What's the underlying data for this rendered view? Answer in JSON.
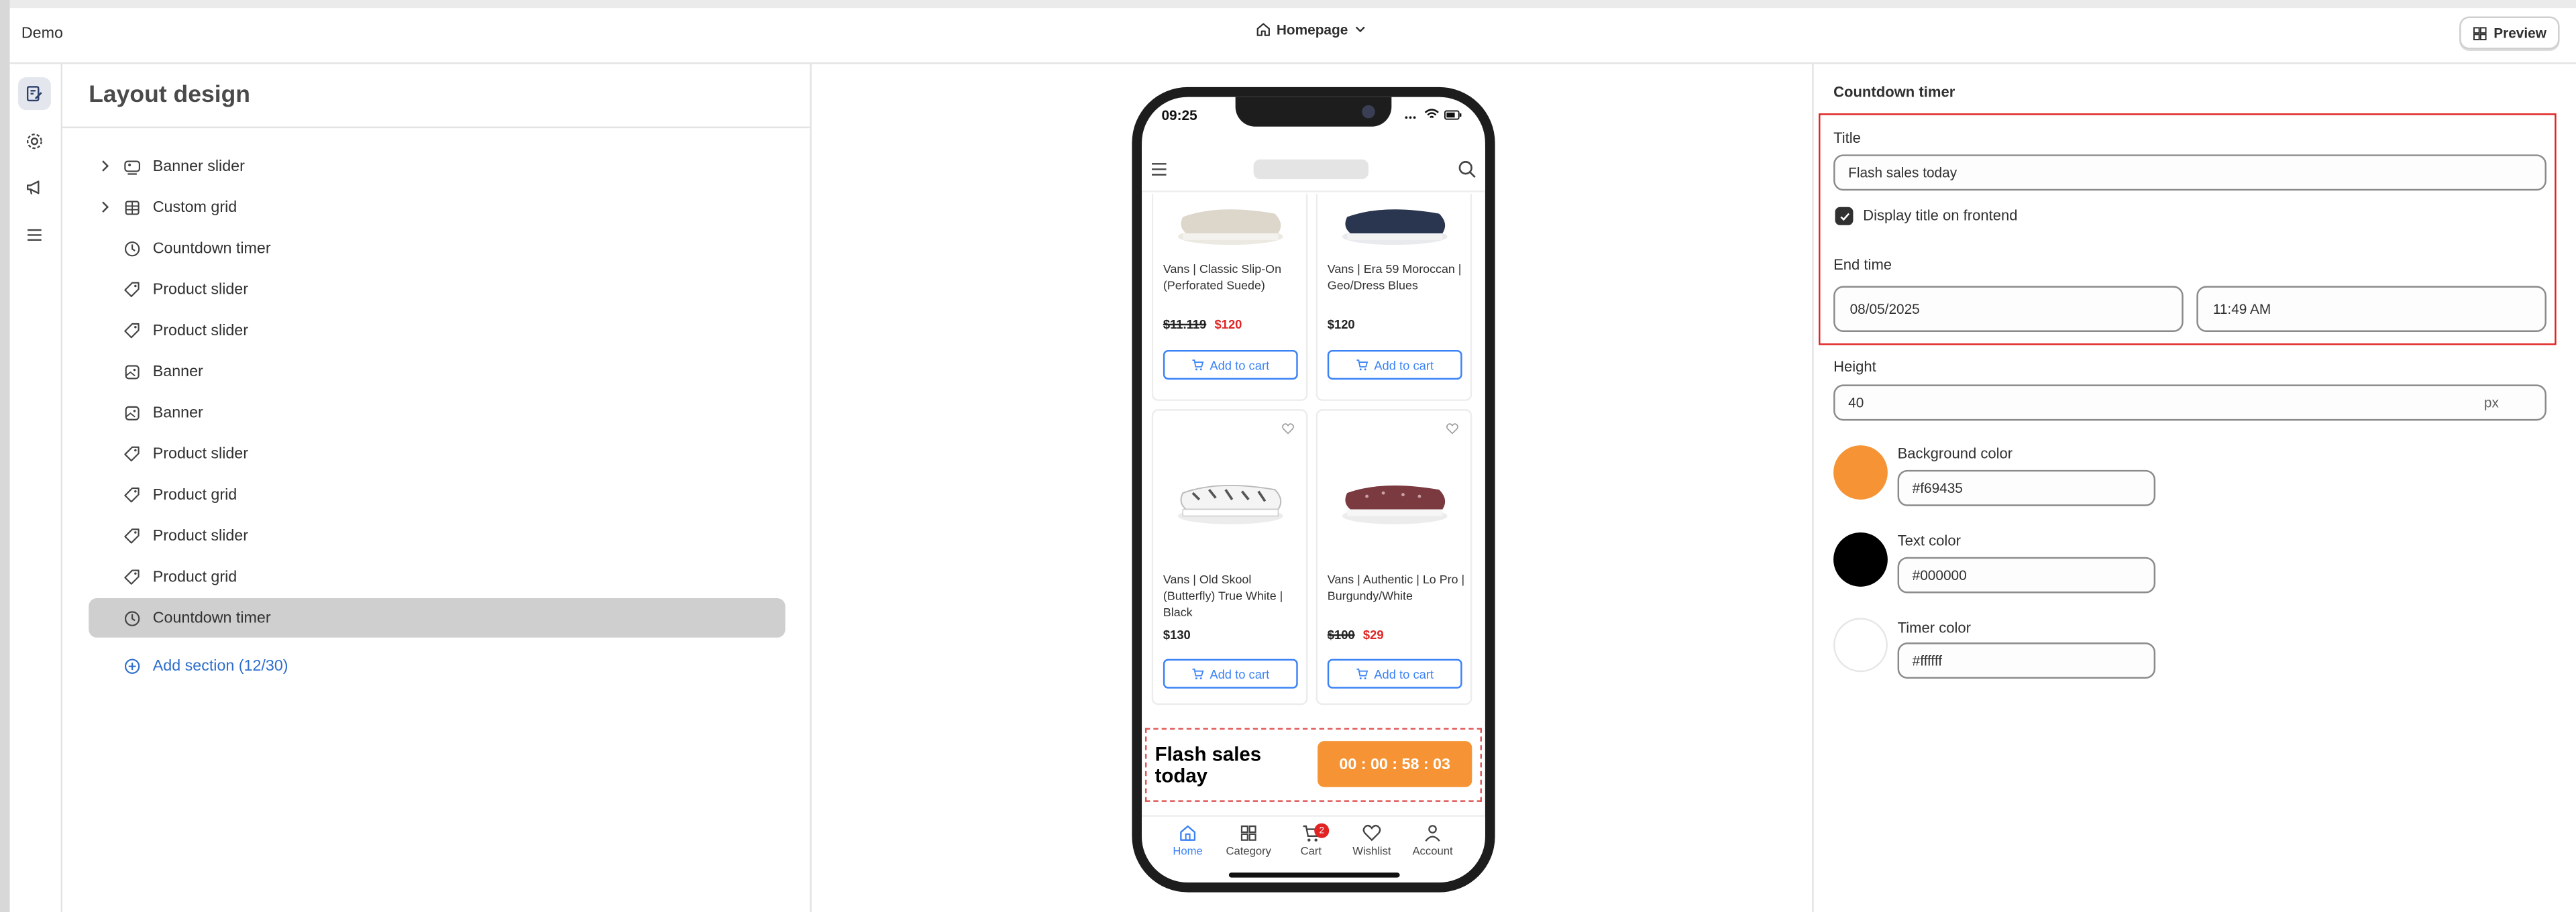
{
  "app": {
    "title": "Demo"
  },
  "topbar": {
    "page_select": "Homepage",
    "preview_label": "Preview"
  },
  "left_panel": {
    "title": "Layout design",
    "sections": [
      {
        "label": "Banner slider",
        "icon": "banner-slider-icon",
        "expandable": true
      },
      {
        "label": "Custom grid",
        "icon": "grid-icon",
        "expandable": true
      },
      {
        "label": "Countdown timer",
        "icon": "clock-icon",
        "expandable": false
      },
      {
        "label": "Product slider",
        "icon": "tag-icon",
        "expandable": false
      },
      {
        "label": "Product slider",
        "icon": "tag-icon",
        "expandable": false
      },
      {
        "label": "Banner",
        "icon": "image-icon",
        "expandable": false
      },
      {
        "label": "Banner",
        "icon": "image-icon",
        "expandable": false
      },
      {
        "label": "Product slider",
        "icon": "tag-icon",
        "expandable": false
      },
      {
        "label": "Product grid",
        "icon": "tag-icon",
        "expandable": false
      },
      {
        "label": "Product slider",
        "icon": "tag-icon",
        "expandable": false
      },
      {
        "label": "Product grid",
        "icon": "tag-icon",
        "expandable": false
      },
      {
        "label": "Countdown timer",
        "icon": "clock-icon",
        "expandable": false,
        "selected": true
      }
    ],
    "add_section_label": "Add section (12/30)"
  },
  "preview": {
    "status_time": "09:25",
    "products": [
      {
        "name": "Vans | Classic Slip-On (Perforated Suede)",
        "old_price": "$11.119",
        "price": "$120",
        "on_sale": true,
        "add_label": "Add to cart"
      },
      {
        "name": "Vans | Era 59 Moroccan | Geo/Dress Blues",
        "price": "$120",
        "on_sale": false,
        "add_label": "Add to cart"
      },
      {
        "name": "Vans | Old Skool (Butterfly) True White | Black",
        "price": "$130",
        "on_sale": false,
        "add_label": "Add to cart"
      },
      {
        "name": "Vans | Authentic | Lo Pro | Burgundy/White",
        "old_price": "$100",
        "price": "$29",
        "on_sale": true,
        "add_label": "Add to cart"
      }
    ],
    "countdown": {
      "title": "Flash sales today",
      "timer": "00 : 00 : 58 : 03"
    },
    "nav": [
      {
        "label": "Home",
        "icon": "home-icon",
        "active": true
      },
      {
        "label": "Category",
        "icon": "category-icon"
      },
      {
        "label": "Cart",
        "icon": "cart-icon",
        "badge": "2"
      },
      {
        "label": "Wishlist",
        "icon": "heart-icon"
      },
      {
        "label": "Account",
        "icon": "user-icon"
      }
    ]
  },
  "settings": {
    "section_title": "Countdown timer",
    "title_label": "Title",
    "title_value": "Flash sales today",
    "display_title_label": "Display title on frontend",
    "display_title_checked": true,
    "end_time_label": "End time",
    "end_date": "08/05/2025",
    "end_time": "11:49 AM",
    "height_label": "Height",
    "height_value": "40",
    "height_unit": "px",
    "background_color_label": "Background color",
    "background_color": "#f69435",
    "text_color_label": "Text color",
    "text_color": "#000000",
    "timer_color_label": "Timer color",
    "timer_color": "#ffffff"
  },
  "colors": {
    "accent": "#f69435",
    "link": "#2c6ecb",
    "highlight": "#e02424",
    "cart_button": "#3b82f6"
  }
}
